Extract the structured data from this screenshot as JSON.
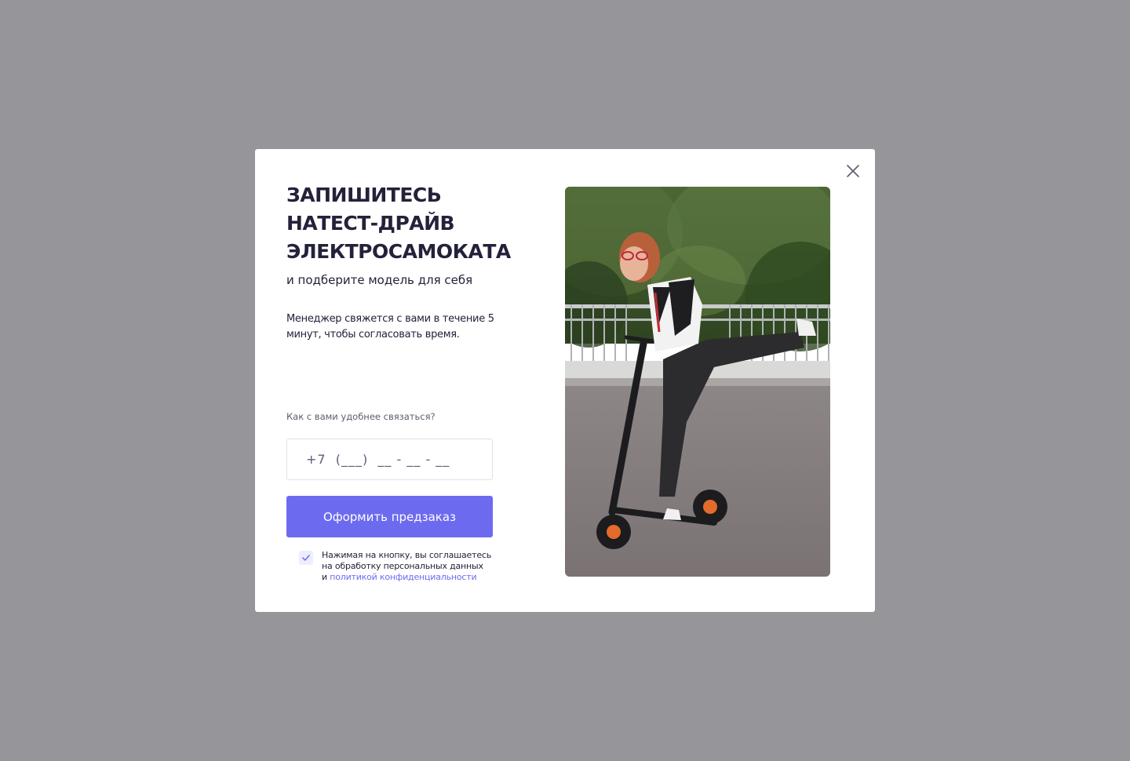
{
  "modal": {
    "title_lines": [
      "ЗАПИШИТЕСЬ",
      "НАТЕСТ-ДРАЙВ",
      "ЭЛЕКТРОСАМОКАТА"
    ],
    "subtitle": "и подберите модель для себя",
    "description": "Менеджер свяжется с вами в течение 5 минут, чтобы согласовать время.",
    "contact_label": "Как с вами удобнее связаться?",
    "phone_placeholder": "+7  (___)  __ - __ - __",
    "submit_label": "Оформить предзаказ",
    "consent": {
      "line1": "Нажимая на кнопку, вы соглашаетесь",
      "line2": "на обработку персональных данных",
      "prefix": "и ",
      "link": "политикой конфиденциальности",
      "checked": true
    },
    "close_icon": "close-icon",
    "photo_icon": "scooter-photo"
  },
  "colors": {
    "overlay": "#96969a",
    "accent": "#6c6bf0",
    "text": "#23223a",
    "muted": "#5c5c6c"
  }
}
